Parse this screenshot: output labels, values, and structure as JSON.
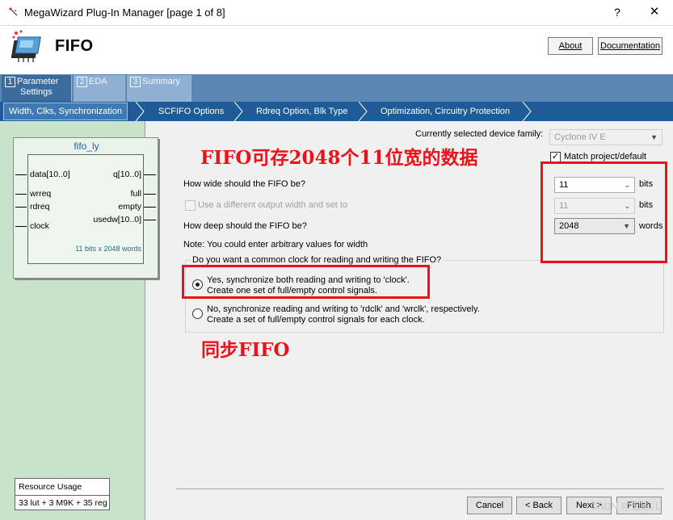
{
  "window": {
    "title": "MegaWizard Plug-In Manager [page 1 of 8]",
    "help": "?",
    "close": "✕"
  },
  "header": {
    "title": "FIFO",
    "about_label": "About",
    "documentation_label": "Documentation"
  },
  "top_tabs": [
    {
      "num": "1",
      "label1": "Parameter",
      "label2": "Settings"
    },
    {
      "num": "2",
      "label1": "EDA",
      "label2": ""
    },
    {
      "num": "3",
      "label1": "Summary",
      "label2": ""
    }
  ],
  "sub_tabs": [
    "Width, Clks, Synchronization",
    "SCFIFO Options",
    "Rdreq Option, Blk Type",
    "Optimization, Circuitry Protection"
  ],
  "block": {
    "name": "fifo_ly",
    "inputs": [
      "data[10..0]",
      "wrreq",
      "rdreq",
      "clock"
    ],
    "outputs": [
      "q[10..0]",
      "full",
      "empty",
      "usedw[10..0]"
    ],
    "note": "11 bits x 2048 words"
  },
  "resource": {
    "title": "Resource Usage",
    "value": "33 lut + 3 M9K + 35 reg"
  },
  "form": {
    "device_family_label": "Currently selected device family:",
    "device_family_value": "Cyclone IV E",
    "match_project_label": "Match project/default",
    "width_question": "How wide should the FIFO be?",
    "width_value": "11",
    "width_unit": "bits",
    "diff_width_label": "Use a different output width and set to",
    "diff_width_value": "11",
    "diff_width_unit": "bits",
    "depth_question": "How deep should the FIFO be?",
    "depth_value": "2048",
    "depth_unit": "words",
    "note": "Note: You could enter arbitrary values for width",
    "clock_question": "Do you want a common clock for reading and writing the FIFO?",
    "option_yes_line1": "Yes, synchronize both reading and writing to 'clock'.",
    "option_yes_line2": "Create one set of full/empty control signals.",
    "option_no_line1": "No, synchronize reading and writing to 'rdclk' and 'wrclk', respectively.",
    "option_no_line2": "Create a set of full/empty control signals for each clock."
  },
  "annotations": {
    "capacity": "FIFO可存2048个11位宽的数据",
    "sync": "同步FIFO",
    "color": "#e8131b"
  },
  "footer": {
    "cancel": "Cancel",
    "back": "< Back",
    "next": "Next >",
    "finish": "Finish",
    "watermark": "CSDN @无影儿"
  }
}
